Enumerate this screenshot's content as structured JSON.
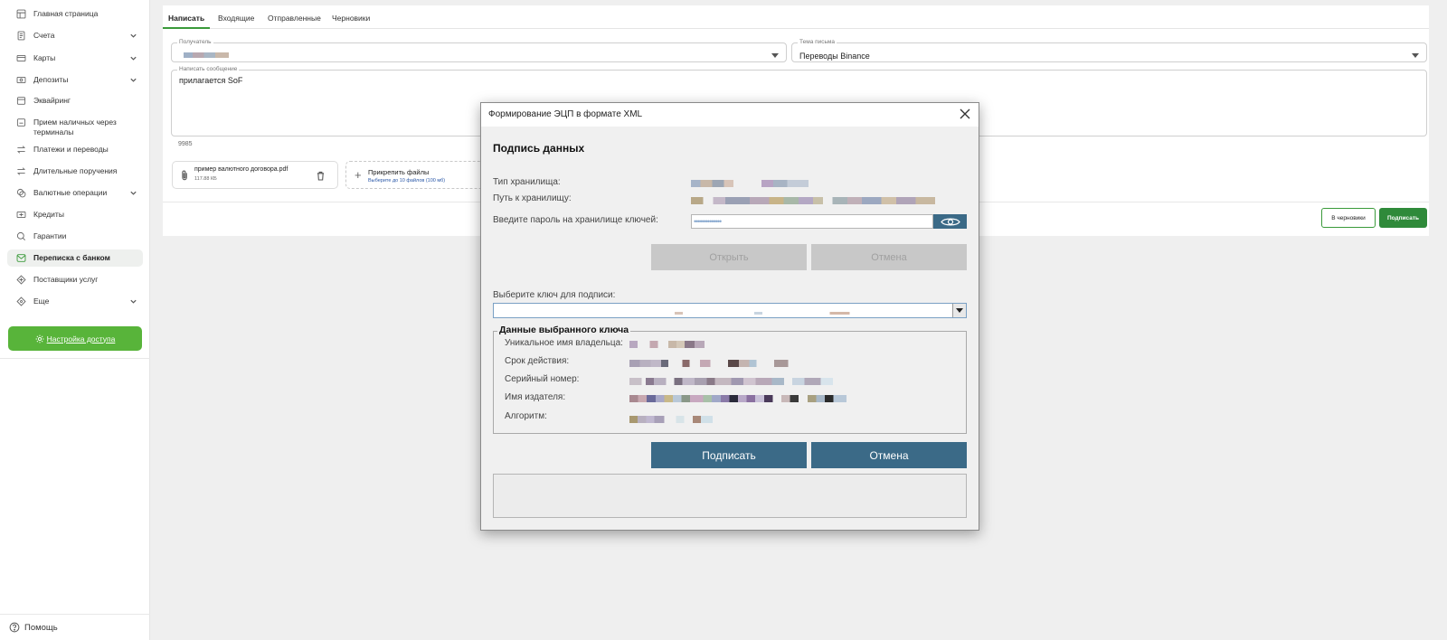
{
  "sidebar": {
    "items": [
      {
        "label": "Главная страница",
        "icon": "layout-icon",
        "chevron": false
      },
      {
        "label": "Счета",
        "icon": "document-icon",
        "chevron": true
      },
      {
        "label": "Карты",
        "icon": "card-icon",
        "chevron": true
      },
      {
        "label": "Депозиты",
        "icon": "deposit-icon",
        "chevron": true
      },
      {
        "label": "Эквайринг",
        "icon": "terminal-icon",
        "chevron": false
      },
      {
        "label": "Прием наличных через терминалы",
        "icon": "cash-terminal-icon",
        "chevron": false
      },
      {
        "label": "Платежи и переводы",
        "icon": "transfer-icon",
        "chevron": false
      },
      {
        "label": "Длительные поручения",
        "icon": "transfer-icon",
        "chevron": false
      },
      {
        "label": "Валютные операции",
        "icon": "currency-icon",
        "chevron": true
      },
      {
        "label": "Кредиты",
        "icon": "credit-icon",
        "chevron": false
      },
      {
        "label": "Гарантии",
        "icon": "guarantee-icon",
        "chevron": false
      },
      {
        "label": "Переписка с банком",
        "icon": "mail-icon",
        "chevron": false,
        "active": true
      },
      {
        "label": "Поставщики услуг",
        "icon": "providers-icon",
        "chevron": false
      },
      {
        "label": "Еще",
        "icon": "more-icon",
        "chevron": true
      }
    ],
    "access_button": "Настройка доступа",
    "help": "Помощь"
  },
  "tabs": [
    "Написать",
    "Входящие",
    "Отправленные",
    "Черновики"
  ],
  "form": {
    "recipient_label": "Получатель",
    "subject_label": "Тема письма",
    "subject_value": "Переводы Binance",
    "message_label": "Написать сообщение",
    "message_value": "прилагается SoF",
    "counter": "9985"
  },
  "attachment": {
    "file_name": "пример валютного договора.pdf",
    "file_size": "117.88 КБ",
    "add_title": "Прикрепить файлы",
    "add_hint": "Выберите до 10 файлов (100 мб)"
  },
  "actions": {
    "draft": "В черновики",
    "sign": "Подписать"
  },
  "dialog": {
    "title": "Формирование ЭЦП в формате XML",
    "heading": "Подпись данных",
    "storage_type_label": "Тип хранилища:",
    "storage_path_label": "Путь к хранилищу:",
    "password_label": "Введите пароль на хранилище ключей:",
    "password_mask": "••••••••••••••",
    "open_button": "Открыть",
    "cancel_button_top": "Отмена",
    "select_key_label": "Выберите ключ для подписи:",
    "group_title": "Данные выбранного ключа",
    "owner_label": "Уникальное имя владельца:",
    "validity_label": "Срок действия:",
    "serial_label": "Серийный номер:",
    "issuer_label": "Имя издателя:",
    "algorithm_label": "Алгоритм:",
    "sign_button": "Подписать",
    "cancel_button": "Отмена"
  },
  "colors": {
    "accent_green": "#58b43a",
    "sign_green": "#2f8a3a",
    "dialog_button": "#3b6a87"
  }
}
